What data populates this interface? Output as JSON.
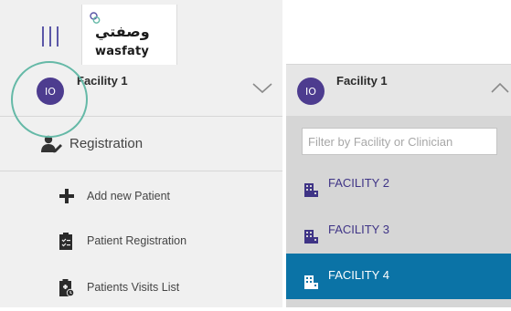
{
  "logo": {
    "arabic": "وصفتي",
    "latin": "wasfaty"
  },
  "current_facility": {
    "initials": "IO",
    "name": "Facility 1"
  },
  "nav": {
    "section_label": "Registration",
    "items": [
      {
        "label": "Add new Patient",
        "icon": "plus-icon"
      },
      {
        "label": "Patient Registration",
        "icon": "clipboard-icon"
      },
      {
        "label": "Patients Visits List",
        "icon": "clipboard-clock-icon"
      }
    ]
  },
  "facility_switcher": {
    "filter_placeholder": "Filter by Facility or Clinician",
    "options": [
      {
        "label": "FACILITY 2",
        "selected": false
      },
      {
        "label": "FACILITY 3",
        "selected": false
      },
      {
        "label": "FACILITY 4",
        "selected": true
      }
    ]
  },
  "colors": {
    "avatar_bg": "#4d3c8f",
    "highlight_ring": "#65b9a7",
    "selected_bg": "#0b73a6",
    "option_text": "#3f3486",
    "panel_bg": "#f0f0f0",
    "dropdown_bg": "#d6d6d6"
  }
}
